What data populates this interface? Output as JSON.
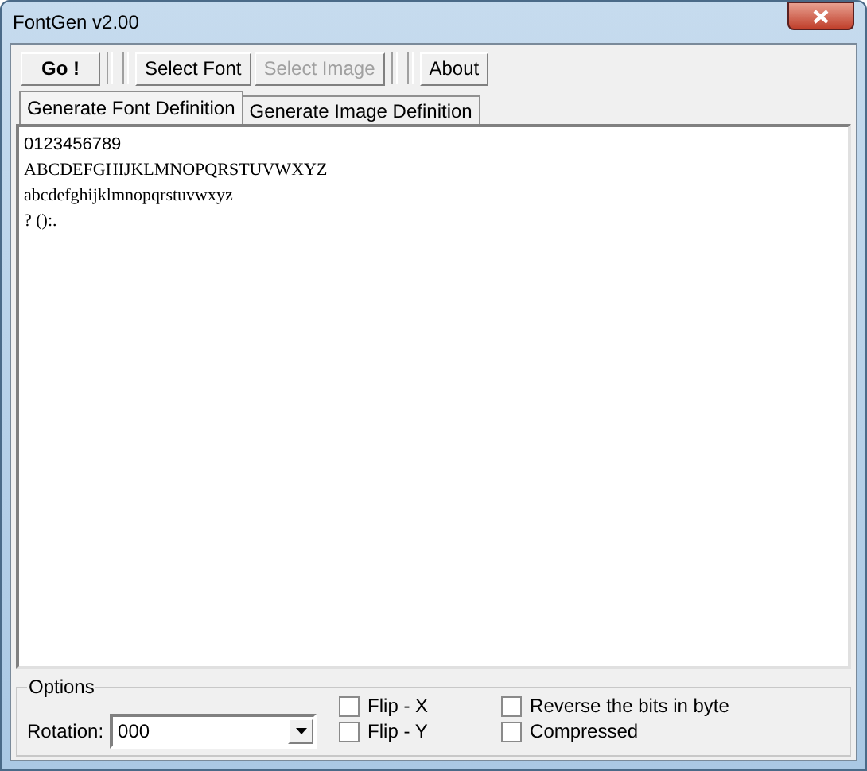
{
  "window": {
    "title": "FontGen v2.00"
  },
  "toolbar": [
    {
      "kind": "button",
      "label": "Go !",
      "bold": true,
      "disabled": false
    },
    {
      "kind": "separator"
    },
    {
      "kind": "separator"
    },
    {
      "kind": "button",
      "label": "Select Font",
      "bold": false,
      "disabled": false
    },
    {
      "kind": "button",
      "label": "Select Image",
      "bold": false,
      "disabled": true
    },
    {
      "kind": "separator"
    },
    {
      "kind": "separator"
    },
    {
      "kind": "button",
      "label": "About",
      "bold": false,
      "disabled": false
    }
  ],
  "tabs": [
    {
      "label": "Generate Font Definition",
      "selected": true
    },
    {
      "label": "Generate Image Definition",
      "selected": false
    }
  ],
  "preview_lines": [
    "0123456789",
    "ABCDEFGHIJKLMNOPQRSTUVWXYZ",
    "abcdefghijklmnopqrstuvwxyz",
    "? ():."
  ],
  "options": {
    "title": "Options",
    "rotation_label": "Rotation:",
    "rotation_value": "000",
    "checkboxes": [
      {
        "label": "Flip - X",
        "checked": false
      },
      {
        "label": "Flip - Y",
        "checked": false
      },
      {
        "label": "Reverse the bits in byte",
        "checked": false
      },
      {
        "label": "Compressed",
        "checked": false
      }
    ]
  }
}
